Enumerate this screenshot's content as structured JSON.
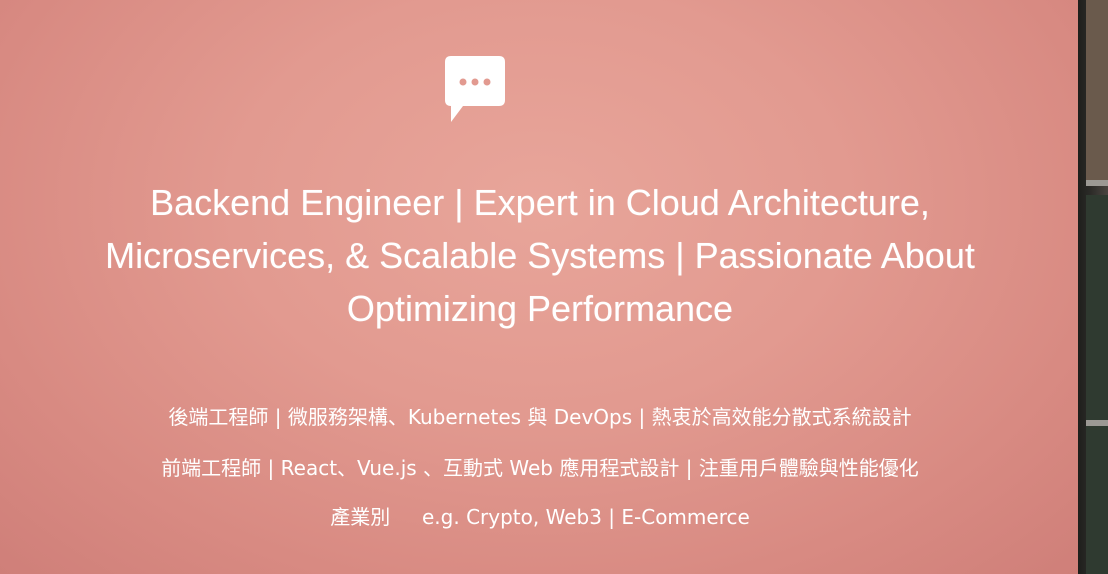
{
  "slide": {
    "icon": "chat-bubble-icon",
    "title_lines": [
      "Backend Engineer | Expert in Cloud Architecture,",
      "Microservices, & Scalable Systems | Passionate About",
      "Optimizing Performance"
    ],
    "subtitle_lines": [
      "後端工程師 | 微服務架構、Kubernetes 與 DevOps | 熱衷於高效能分散式系統設計",
      "前端工程師 |  React、Vue.js 、互動式 Web 應用程式設計 | 注重用戶體驗與性能優化",
      "產業別     e.g. Crypto, Web3 | E-Commerce"
    ]
  },
  "colors": {
    "slide_background": "#e29a90",
    "text": "#ffffff",
    "icon_fill": "#ffffff"
  }
}
